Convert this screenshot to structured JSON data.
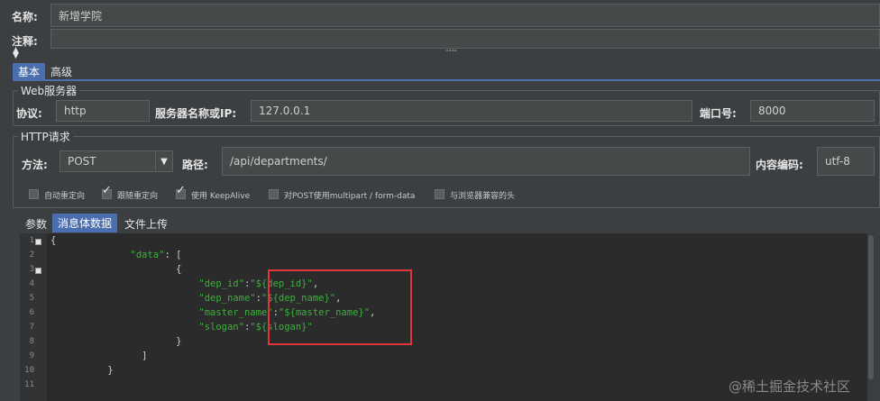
{
  "form": {
    "name_label": "名称:",
    "name_value": "新增学院",
    "comment_label": "注释:",
    "splitter_grip": "\"\"\"\""
  },
  "tabs": [
    {
      "label": "基本"
    },
    {
      "label": "高级"
    }
  ],
  "web_server": {
    "title": "Web服务器",
    "protocol_label": "协议:",
    "protocol_value": "http",
    "server_label": "服务器名称或IP:",
    "server_value": "127.0.0.1",
    "port_label": "端口号:",
    "port_value": "8000"
  },
  "http_request": {
    "title": "HTTP请求",
    "method_label": "方法:",
    "method_value": "POST",
    "path_label": "路径:",
    "path_value": "/api/departments/",
    "encoding_label": "内容编码:",
    "encoding_value": "utf-8",
    "checkboxes": [
      {
        "label": "自动重定向",
        "checked": false
      },
      {
        "label": "跟随重定向",
        "checked": true
      },
      {
        "label": "使用 KeepAlive",
        "checked": true
      },
      {
        "label": "对POST使用multipart / form-data",
        "checked": false
      },
      {
        "label": "与浏览器兼容的头",
        "checked": false
      }
    ]
  },
  "body_tabs": [
    {
      "label": "参数"
    },
    {
      "label": "消息体数据"
    },
    {
      "label": "文件上传"
    }
  ],
  "editor": {
    "line_numbers": [
      "1",
      "2",
      "3",
      "4",
      "5",
      "6",
      "7",
      "8",
      "9",
      "10",
      "11"
    ],
    "lines": [
      {
        "indent": "",
        "key": "",
        "text": "{"
      },
      {
        "indent": "              ",
        "key": "\"data\"",
        "text": ": ["
      },
      {
        "indent": "                      ",
        "key": "",
        "text": "{"
      },
      {
        "indent": "                          ",
        "key": "\"dep_id\"",
        "sep": ":",
        "val": "\"${dep_id}\"",
        "end": ","
      },
      {
        "indent": "                          ",
        "key": "\"dep_name\"",
        "sep": ":",
        "val": "\"${dep_name}\"",
        "end": ","
      },
      {
        "indent": "                          ",
        "key": "\"master_name\"",
        "sep": ":",
        "val": "\"${master_name}\"",
        "end": ","
      },
      {
        "indent": "                          ",
        "key": "\"slogan\"",
        "sep": ":",
        "val": "\"${slogan}\"",
        "end": ""
      },
      {
        "indent": "                      ",
        "key": "",
        "text": "}"
      },
      {
        "indent": "                ",
        "key": "",
        "text": "]"
      },
      {
        "indent": "          ",
        "key": "",
        "text": "}"
      },
      {
        "indent": "",
        "key": "",
        "text": ""
      }
    ]
  },
  "watermark": "@稀土掘金技术社区",
  "colors": {
    "background": "#3c3f41",
    "field_bg": "#45494a",
    "active_tab": "#4b6eaf",
    "editor_bg": "#2b2b2b",
    "json_string": "#3fae3f",
    "highlight_box": "#e0353a"
  }
}
